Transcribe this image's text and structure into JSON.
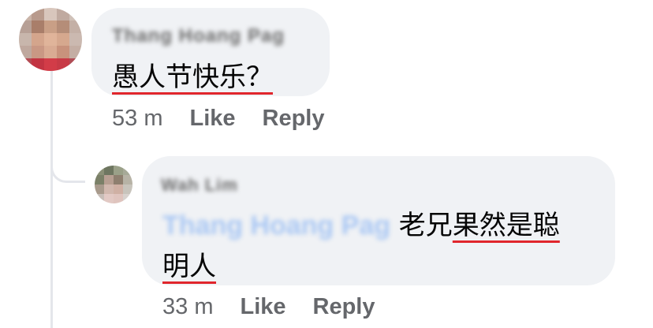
{
  "comments": [
    {
      "author": "Thang Hoang Pag",
      "text": "愚人节快乐？",
      "time": "53 m",
      "like_label": "Like",
      "reply_label": "Reply"
    },
    {
      "author": "Wah Lim",
      "mention": "Thang Hoang Pag",
      "text_plain": " 老兄",
      "text_underlined_1": "果然是聪",
      "text_underlined_2": "明人",
      "time": "33 m",
      "like_label": "Like",
      "reply_label": "Reply"
    }
  ],
  "colors": {
    "bubble_bg": "#f0f2f5",
    "meta_text": "#65676b",
    "mention_blue": "#a9c7f3",
    "spellcheck_underline": "#e0262c"
  }
}
